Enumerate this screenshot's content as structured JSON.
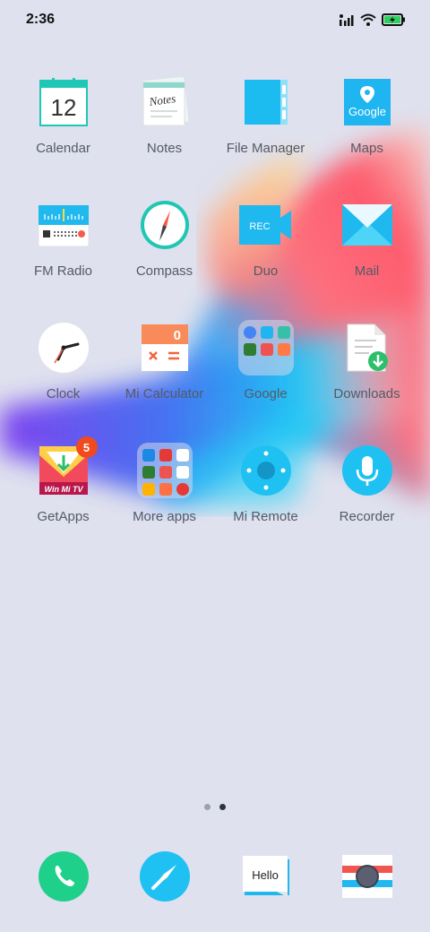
{
  "status_bar": {
    "time": "2:36",
    "icons": [
      "signal-icon",
      "wifi-icon",
      "battery-charging-icon"
    ]
  },
  "colors": {
    "background": "#dfe1ee",
    "badge": "#f04a1e",
    "accent_blue": "#1fc1f3"
  },
  "apps": {
    "calendar": {
      "label": "Calendar",
      "date": "12"
    },
    "notes": {
      "label": "Notes",
      "icon_text": "Notes"
    },
    "file_manager": {
      "label": "File Manager"
    },
    "maps": {
      "label": "Maps",
      "icon_text": "Google"
    },
    "fm_radio": {
      "label": "FM Radio"
    },
    "compass": {
      "label": "Compass"
    },
    "duo": {
      "label": "Duo",
      "icon_text": "REC"
    },
    "mail": {
      "label": "Mail"
    },
    "clock": {
      "label": "Clock"
    },
    "calculator": {
      "label": "Mi Calculator",
      "display": "0"
    },
    "google_folder": {
      "label": "Google"
    },
    "downloads": {
      "label": "Downloads"
    },
    "getapps": {
      "label": "GetApps",
      "badge": "5",
      "banner": "Win Mi TV"
    },
    "more_apps": {
      "label": "More apps"
    },
    "mi_remote": {
      "label": "Mi Remote"
    },
    "recorder": {
      "label": "Recorder"
    }
  },
  "pager": {
    "pages": 2,
    "current": 2
  },
  "dock": {
    "phone": {
      "icon": "phone-icon"
    },
    "browser": {
      "icon": "browser-icon"
    },
    "messages": {
      "icon_text": "Hello"
    },
    "camera": {
      "icon": "camera-icon"
    }
  }
}
